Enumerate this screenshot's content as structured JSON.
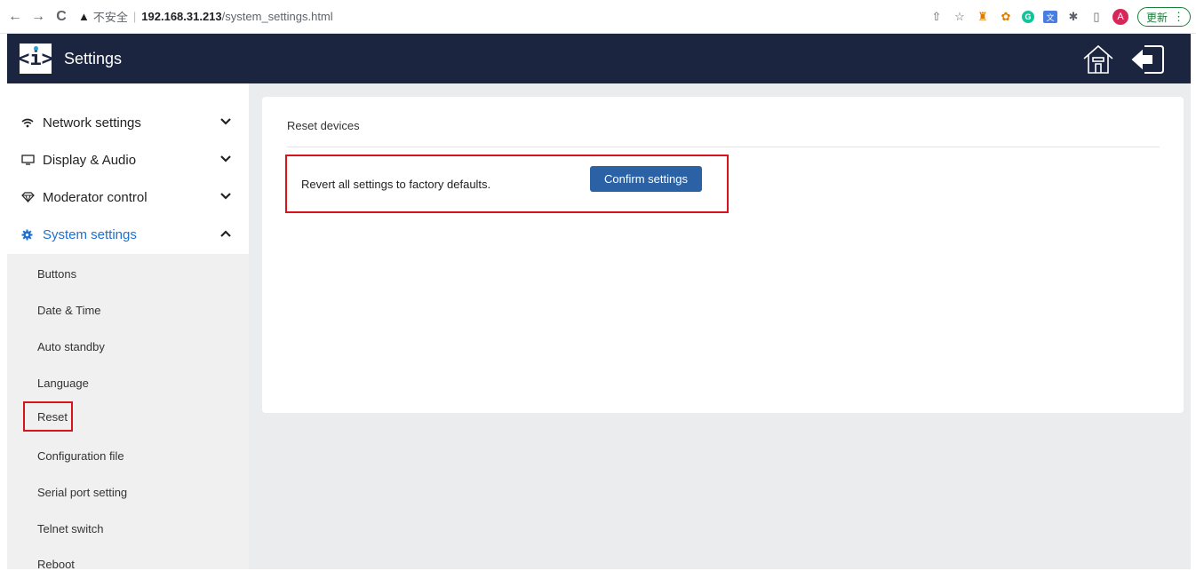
{
  "browser": {
    "back_icon": "←",
    "forward_icon": "→",
    "reload_icon": "C",
    "warning_icon": "▲",
    "insecure_label": "不安全",
    "separator": "|",
    "url_host": "192.168.31.213",
    "url_path": "/system_settings.html",
    "share_icon": "⇧",
    "bookmark_icon": "☆",
    "ext_puzzle_icon": "✱",
    "sidebar_icon": "▯",
    "avatar_letter": "A",
    "update_label": "更新",
    "menu_icon": "⋮"
  },
  "header": {
    "logo_text": "<i>",
    "title": "Settings"
  },
  "sidebar": {
    "items": [
      {
        "label": "Network settings",
        "chevron": "▾"
      },
      {
        "label": "Display & Audio",
        "chevron": "▾"
      },
      {
        "label": "Moderator control",
        "chevron": "▾"
      },
      {
        "label": "System settings",
        "chevron": "▴"
      }
    ],
    "sub_items": [
      "Buttons",
      "Date & Time",
      "Auto standby",
      "Language",
      "Reset",
      "Configuration file",
      "Serial port setting",
      "Telnet switch",
      "Reboot"
    ]
  },
  "main": {
    "card_title": "Reset devices",
    "revert_text": "Revert all settings to factory defaults.",
    "confirm_label": "Confirm settings"
  },
  "colors": {
    "header_bg": "#1c2540",
    "active_blue": "#1f6fd1",
    "button_blue": "#2b62a6",
    "highlight_red": "#d6141e",
    "main_bg": "#eaecee"
  }
}
